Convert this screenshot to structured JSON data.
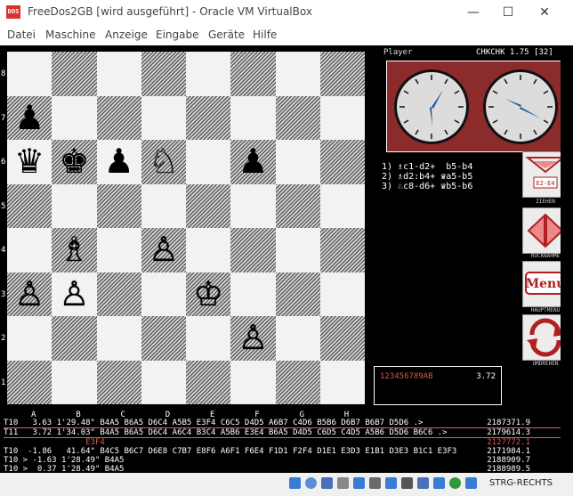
{
  "window": {
    "app_icon_text": "DOS",
    "title": "FreeDos2GB [wird ausgeführt] - Oracle VM VirtualBox",
    "controls": {
      "minimize": "—",
      "maximize": "☐",
      "close": "✕"
    }
  },
  "menubar": [
    "Datei",
    "Maschine",
    "Anzeige",
    "Eingabe",
    "Geräte",
    "Hilfe"
  ],
  "game": {
    "player_label": "Player",
    "program": "CHKCHK 1.75 [32]",
    "files": [
      "A",
      "B",
      "C",
      "D",
      "E",
      "F",
      "G",
      "H"
    ],
    "ranks": [
      "8",
      "7",
      "6",
      "5",
      "4",
      "3",
      "2",
      "1"
    ],
    "pieces": [
      {
        "square": "a7",
        "glyph": "♟",
        "color": "black"
      },
      {
        "square": "a6",
        "glyph": "♛",
        "color": "black"
      },
      {
        "square": "b6",
        "glyph": "♚",
        "color": "black"
      },
      {
        "square": "c6",
        "glyph": "♟",
        "color": "black"
      },
      {
        "square": "d6",
        "glyph": "♘",
        "color": "white"
      },
      {
        "square": "f6",
        "glyph": "♟",
        "color": "black"
      },
      {
        "square": "b4",
        "glyph": "♗",
        "color": "white"
      },
      {
        "square": "d4",
        "glyph": "♙",
        "color": "white"
      },
      {
        "square": "a3",
        "glyph": "♙",
        "color": "white"
      },
      {
        "square": "b3",
        "glyph": "♙",
        "color": "white"
      },
      {
        "square": "e3",
        "glyph": "♔",
        "color": "white"
      },
      {
        "square": "f2",
        "glyph": "♙",
        "color": "white"
      }
    ],
    "moves": [
      "1) ♗c1-d2+  b5-b4",
      "2) ♗d2:b4+ ♛a5-b5",
      "3) ♘c8-d6+ ♛b5-b6"
    ],
    "buttons": [
      {
        "id": "ziehen",
        "caption": "ZIEHEN",
        "inner": "E2-E4"
      },
      {
        "id": "ruecknahme",
        "caption": "RÜCKNAHME",
        "inner": ""
      },
      {
        "id": "hauptmenue",
        "caption": "HAUPTMENÜ",
        "inner": "Menu"
      },
      {
        "id": "umdrehen",
        "caption": "UMDREHEN",
        "inner": ""
      }
    ],
    "status_digits": "123456789AB",
    "status_score": "3.72",
    "analysis": [
      {
        "text": "T10   3.63 1'29.48\" B4A5 B6A5 D6C4 A5B5 E3F4 C6C5 D4D5 A6B7 C4D6 B5B6 D6B7 B6B7 D5D6 .>",
        "nodes": "2187371.9",
        "hl": false
      },
      {
        "text": "T11   3.72 1'34.03\" B4A5 B6A5 D6C4 A6C4 B3C4 A5B6 E3E4 B6A5 D4D5 C6D5 C4D5 A5B6 D5D6 B6C6 .>",
        "nodes": "2179614.3",
        "hl": true
      },
      {
        "text": "                 E3F4",
        "nodes": "2127772.1",
        "hl": false
      },
      {
        "text": "T10  -1.86   41.64\" B4C5 B6C7 D6E8 C7B7 E8F6 A6F1 F6E4 F1D1 F2F4 D1E1 E3D3 E1B1 D3E3 B1C1 E3F3",
        "nodes": "2171984.1",
        "hl": false
      },
      {
        "text": "T10 > -1.63 1'28.49\" B4A5",
        "nodes": "2188909.7",
        "hl": false
      },
      {
        "text": "T10 >  0.37 1'28.49\" B4A5",
        "nodes": "2188989.5",
        "hl": false
      }
    ]
  },
  "statusbar": {
    "host_key": "STRG-RECHTS"
  }
}
